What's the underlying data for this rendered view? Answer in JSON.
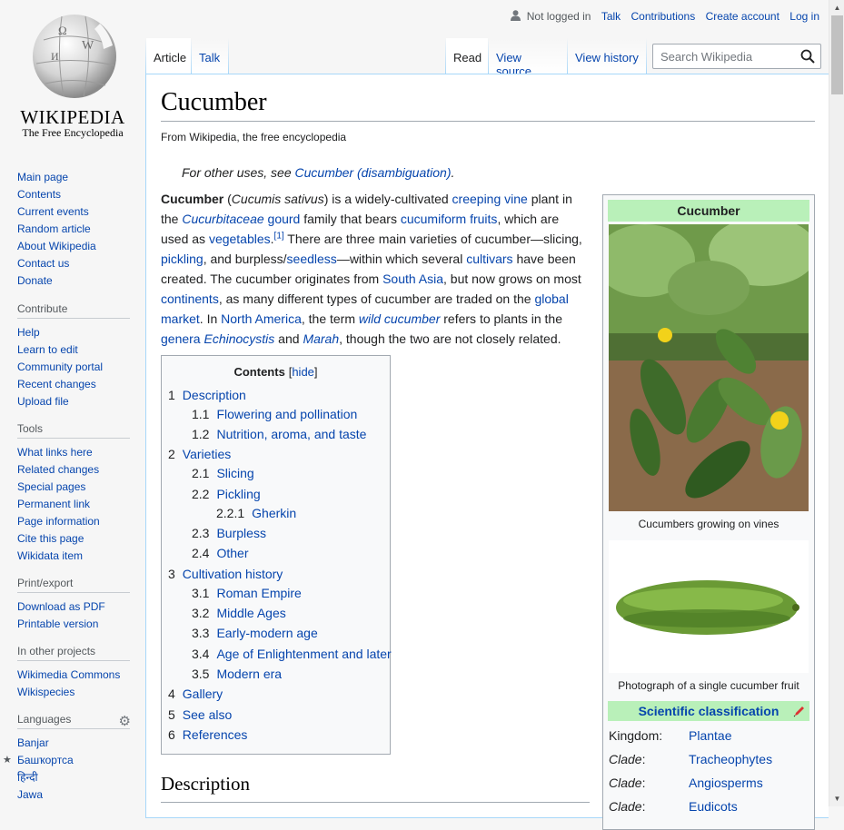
{
  "logo": {
    "wordmark": "WIKIPEDIA",
    "tagline": "The Free Encyclopedia"
  },
  "personal": {
    "not_logged_in": "Not logged in",
    "talk": "Talk",
    "contributions": "Contributions",
    "create_account": "Create account",
    "log_in": "Log in"
  },
  "tabs": {
    "article": "Article",
    "talk": "Talk",
    "read": "Read",
    "view_source": "View source",
    "view_history": "View history"
  },
  "search": {
    "placeholder": "Search Wikipedia"
  },
  "sidebar": {
    "navigation": [
      "Main page",
      "Contents",
      "Current events",
      "Random article",
      "About Wikipedia",
      "Contact us",
      "Donate"
    ],
    "contribute": {
      "heading": "Contribute",
      "items": [
        "Help",
        "Learn to edit",
        "Community portal",
        "Recent changes",
        "Upload file"
      ]
    },
    "tools": {
      "heading": "Tools",
      "items": [
        "What links here",
        "Related changes",
        "Special pages",
        "Permanent link",
        "Page information",
        "Cite this page",
        "Wikidata item"
      ]
    },
    "print": {
      "heading": "Print/export",
      "items": [
        "Download as PDF",
        "Printable version"
      ]
    },
    "projects": {
      "heading": "In other projects",
      "items": [
        "Wikimedia Commons",
        "Wikispecies"
      ]
    },
    "languages": {
      "heading": "Languages",
      "items": [
        "Banjar",
        "Башҡортса",
        "हिन्दी",
        "Jawa"
      ]
    }
  },
  "article": {
    "title": "Cucumber",
    "tagline": "From Wikipedia, the free encyclopedia",
    "hatnote_prefix": "For other uses, see ",
    "hatnote_link": "Cucumber (disambiguation)",
    "hatnote_suffix": ".",
    "lead": {
      "t1": "Cucumber",
      "t2": " (",
      "t3": "Cucumis sativus",
      "t4": ") is a widely-cultivated ",
      "l1": "creeping vine",
      "t5": " plant in the ",
      "l2": "Cucurbitaceae",
      "t6": " ",
      "l3": "gourd",
      "t7": " family that bears ",
      "l4": "cucumiform",
      "t8": " ",
      "l5": "fruits",
      "t9": ", which are used as ",
      "l6": "vegetables",
      "t10": ".",
      "ref": "[1]",
      "t11": " There are three main varieties of cucumber—slicing, ",
      "l7": "pickling",
      "t12": ", and burpless/",
      "l8": "seedless",
      "t13": "—within which several ",
      "l9": "cultivars",
      "t14": " have been created. The cucumber originates from ",
      "l10": "South Asia",
      "t15": ", but now grows on most ",
      "l11": "continents",
      "t16": ", as many different types of cucumber are traded on the ",
      "l12": "global market",
      "t17": ". In ",
      "l13": "North America",
      "t18": ", the term ",
      "l14": "wild cucumber",
      "t19": " refers to plants in the ",
      "l15": "genera",
      "t20": " ",
      "l16": "Echinocystis",
      "t21": " and ",
      "l17": "Marah",
      "t22": ", though the two are not closely related."
    },
    "description_heading": "Description"
  },
  "toc": {
    "title": "Contents",
    "hide_open": "[",
    "hide": "hide",
    "hide_close": "]",
    "items": [
      {
        "num": "1",
        "text": "Description"
      },
      {
        "num": "1.1",
        "text": "Flowering and pollination"
      },
      {
        "num": "1.2",
        "text": "Nutrition, aroma, and taste"
      },
      {
        "num": "2",
        "text": "Varieties"
      },
      {
        "num": "2.1",
        "text": "Slicing"
      },
      {
        "num": "2.2",
        "text": "Pickling"
      },
      {
        "num": "2.2.1",
        "text": "Gherkin"
      },
      {
        "num": "2.3",
        "text": "Burpless"
      },
      {
        "num": "2.4",
        "text": "Other"
      },
      {
        "num": "3",
        "text": "Cultivation history"
      },
      {
        "num": "3.1",
        "text": "Roman Empire"
      },
      {
        "num": "3.2",
        "text": "Middle Ages"
      },
      {
        "num": "3.3",
        "text": "Early-modern age"
      },
      {
        "num": "3.4",
        "text": "Age of Enlightenment and later"
      },
      {
        "num": "3.5",
        "text": "Modern era"
      },
      {
        "num": "4",
        "text": "Gallery"
      },
      {
        "num": "5",
        "text": "See also"
      },
      {
        "num": "6",
        "text": "References"
      }
    ]
  },
  "infobox": {
    "title": "Cucumber",
    "caption1": "Cucumbers growing on vines",
    "caption2": "Photograph of a single cucumber fruit",
    "sci_title": "Scientific classification",
    "taxonomy": [
      {
        "rank": "Kingdom:",
        "value": "Plantae"
      },
      {
        "rank": "Clade",
        "value": "Tracheophytes"
      },
      {
        "rank": "Clade",
        "value": "Angiosperms"
      },
      {
        "rank": "Clade",
        "value": "Eudicots"
      }
    ],
    "colon": ":"
  },
  "colors": {
    "link": "#0645ad",
    "infobox_header": "#b9f0b9",
    "border": "#a7d7f9"
  }
}
